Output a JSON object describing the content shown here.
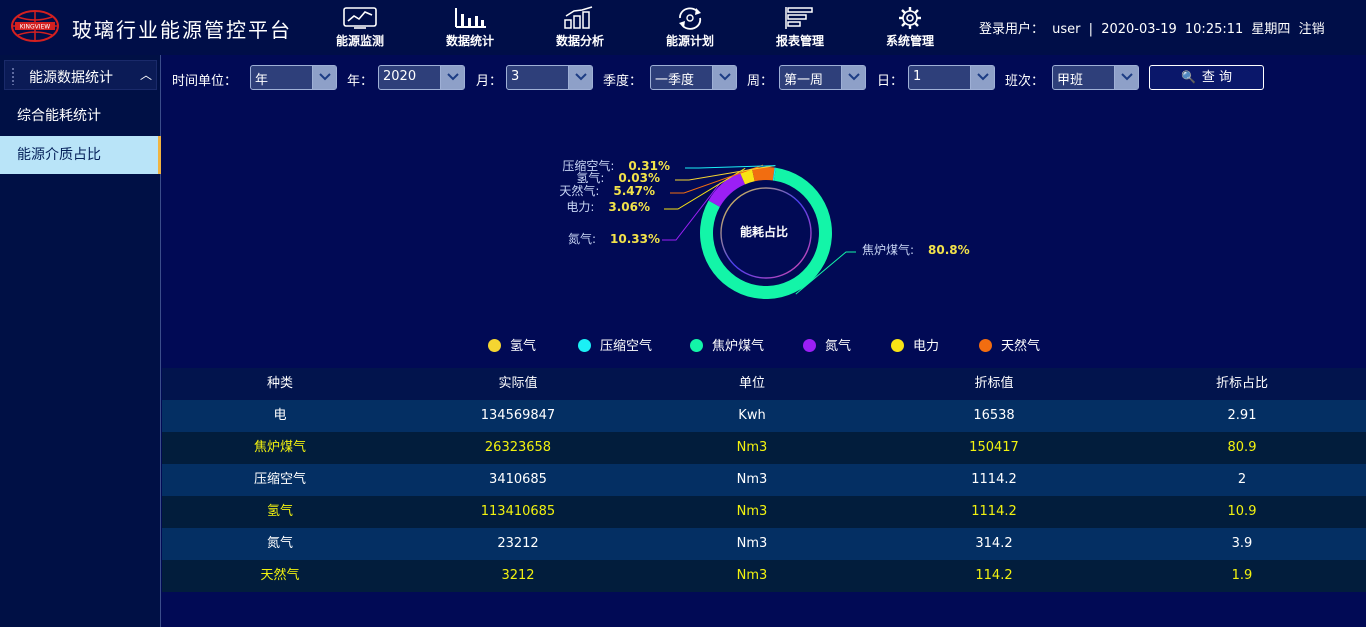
{
  "header": {
    "logo_text": "KINGVIEW",
    "title": "玻璃行业能源管控平台",
    "nav": [
      {
        "label": "能源监测",
        "icon": "line-chart-icon"
      },
      {
        "label": "数据统计",
        "icon": "bar-chart-icon"
      },
      {
        "label": "数据分析",
        "icon": "growth-chart-icon"
      },
      {
        "label": "能源计划",
        "icon": "recycle-icon"
      },
      {
        "label": "报表管理",
        "icon": "report-list-icon"
      },
      {
        "label": "系统管理",
        "icon": "gear-icon"
      }
    ],
    "user_label": "登录用户：",
    "user_name": "user",
    "separator": "|",
    "date": "2020-03-19",
    "time": "10:25:11",
    "weekday": "星期四",
    "logout": "注销"
  },
  "sidebar": {
    "section_title": "能源数据统计",
    "items": [
      {
        "label": "综合能耗统计",
        "active": false
      },
      {
        "label": "能源介质占比",
        "active": true
      }
    ]
  },
  "filters": {
    "time_unit": {
      "label": "时间单位：",
      "value": "年"
    },
    "year": {
      "label": "年：",
      "value": "2020"
    },
    "month": {
      "label": "月：",
      "value": "3"
    },
    "quarter": {
      "label": "季度：",
      "value": "一季度"
    },
    "week": {
      "label": "周：",
      "value": "第一周"
    },
    "day": {
      "label": "日：",
      "value": "1"
    },
    "shift": {
      "label": "班次：",
      "value": "甲班"
    },
    "query_label": "查 询"
  },
  "chart_data": {
    "type": "pie",
    "center_label": "能耗占比",
    "slices": [
      {
        "name": "焦炉煤气",
        "label": "焦炉煤气:",
        "value": 80.8,
        "value_label": "80.8%",
        "color": "#13f5a8"
      },
      {
        "name": "氮气",
        "label": "氮气:",
        "value": 10.33,
        "value_label": "10.33%",
        "color": "#9b1ff5"
      },
      {
        "name": "电力",
        "label": "电力:",
        "value": 3.06,
        "value_label": "3.06%",
        "color": "#f8e315"
      },
      {
        "name": "天然气",
        "label": "天然气:",
        "value": 5.47,
        "value_label": "5.47%",
        "color": "#f26d10"
      },
      {
        "name": "氢气",
        "label": "氢气:",
        "value": 0.03,
        "value_label": "0.03%",
        "color": "#f5d531"
      },
      {
        "name": "压缩空气",
        "label": "压缩空气:",
        "value": 0.31,
        "value_label": "0.31%",
        "color": "#1bf0f5"
      }
    ],
    "legend": [
      {
        "name": "氢气",
        "color": "#f5d531"
      },
      {
        "name": "压缩空气",
        "color": "#1bf0f5"
      },
      {
        "name": "焦炉煤气",
        "color": "#13f5a8"
      },
      {
        "name": "氮气",
        "color": "#9b1ff5"
      },
      {
        "name": "电力",
        "color": "#f8e315"
      },
      {
        "name": "天然气",
        "color": "#f26d10"
      }
    ],
    "legend_placement": "bottom"
  },
  "table": {
    "columns": [
      "种类",
      "实际值",
      "单位",
      "折标值",
      "折标占比"
    ],
    "rows": [
      [
        "电",
        "134569847",
        "Kwh",
        "16538",
        "2.91"
      ],
      [
        "焦炉煤气",
        "26323658",
        "Nm3",
        "150417",
        "80.9"
      ],
      [
        "压缩空气",
        "3410685",
        "Nm3",
        "1114.2",
        "2"
      ],
      [
        "氢气",
        "113410685",
        "Nm3",
        "1114.2",
        "10.9"
      ],
      [
        "氮气",
        "23212",
        "Nm3",
        "314.2",
        "3.9"
      ],
      [
        "天然气",
        "3212",
        "Nm3",
        "114.2",
        "1.9"
      ]
    ]
  },
  "colors": {
    "background": "#010a55",
    "header_bg": "#000e48",
    "label_yellow": "#f2e24a",
    "row_highlight_text": "#f2f20f"
  }
}
